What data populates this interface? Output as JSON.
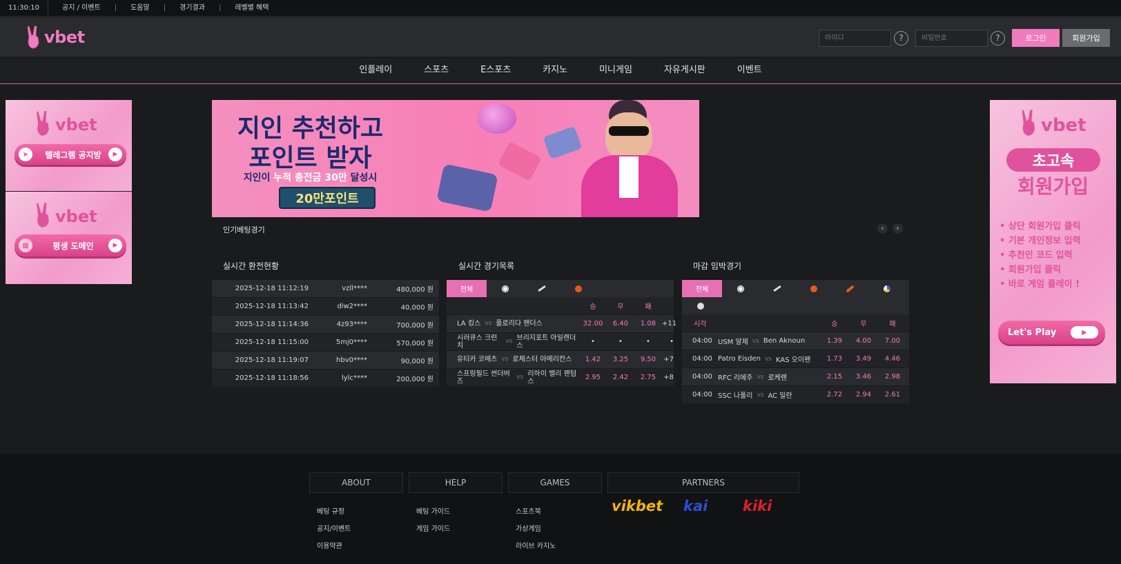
{
  "topbar": {
    "clock": "11:30:10",
    "links": [
      "공지 / 이벤트",
      "도움말",
      "경기결과",
      "레벨별 혜택"
    ]
  },
  "header": {
    "logo": "vbet",
    "id_placeholder": "아이디",
    "pw_placeholder": "비밀번호",
    "login_label": "로그인",
    "join_label": "회원가입"
  },
  "nav": [
    "인플레이",
    "스포츠",
    "E스포츠",
    "카지노",
    "미니게임",
    "자유게시판",
    "이벤트"
  ],
  "left_banners": [
    {
      "logo": "vbet",
      "pill": "텔레그램 공지방"
    },
    {
      "logo": "vbet",
      "pill": "평생 도메인"
    }
  ],
  "right_banner": {
    "logo": "vbet",
    "headline1": "초고속",
    "headline2": "회원가입",
    "steps": [
      "• 상단 회원가입 클릭",
      "• 기본 개인정보 입력",
      "• 추천인 코드 입력",
      "• 회원가입 클릭",
      "• 바로 게임 플레이 !"
    ],
    "cta": "Let's Play"
  },
  "main_banner": {
    "line1a": "지인 추천",
    "line1b": "하고",
    "line2": "포인트 받자",
    "line3a": "지인이 ",
    "line3b": "누적 충전금 30만",
    "line3c": " 달성시",
    "badge": "20만포인트"
  },
  "popular": {
    "label": "인기베팅경기",
    "prev": "‹",
    "next": "›"
  },
  "exchange": {
    "title": "실시간 환전현황",
    "rows": [
      {
        "time": "2025-12-18 11:12:19",
        "user": "vzll****",
        "amount": "480,000 원"
      },
      {
        "time": "2025-12-18 11:13:42",
        "user": "dlw2****",
        "amount": "40,000 원"
      },
      {
        "time": "2025-12-18 11:14:36",
        "user": "4z93****",
        "amount": "700,000 원"
      },
      {
        "time": "2025-12-18 11:15:00",
        "user": "5mj0****",
        "amount": "570,000 원"
      },
      {
        "time": "2025-12-18 11:19:07",
        "user": "hbv0****",
        "amount": "90,000 원"
      },
      {
        "time": "2025-12-18 11:18:56",
        "user": "lylc****",
        "amount": "200,000 원"
      }
    ]
  },
  "live": {
    "title": "실시간 경기목록",
    "tab_all": "전체",
    "col_win": "승",
    "col_draw": "무",
    "col_lose": "패",
    "vs": "vs",
    "rows": [
      {
        "home": "LA 킹스",
        "away": "플로리다 팬더스",
        "w": "32.00",
        "d": "6.40",
        "l": "1.08",
        "more": "+11"
      },
      {
        "home": "시러큐스 크런치",
        "away": "브리지포트 아일랜더스",
        "w": "•",
        "d": "•",
        "l": "•",
        "more": "•"
      },
      {
        "home": "유티카 코메츠",
        "away": "로체스터 아메리칸스",
        "w": "1.42",
        "d": "3.25",
        "l": "9.50",
        "more": "+7"
      },
      {
        "home": "스프링필드 썬더버즈",
        "away": "리하이 밸리 팬텀스",
        "w": "2.95",
        "d": "2.42",
        "l": "2.75",
        "more": "+8"
      }
    ]
  },
  "closing": {
    "title": "마감 임박경기",
    "tab_all": "전체",
    "col_time": "시각",
    "col_win": "승",
    "col_draw": "무",
    "col_lose": "패",
    "vs": "vs",
    "rows": [
      {
        "time": "04:00",
        "home": "USM 알제",
        "away": "Ben Aknoun",
        "w": "1.39",
        "d": "4.00",
        "l": "7.00"
      },
      {
        "time": "04:00",
        "home": "Patro Eisden",
        "away": "KAS 오이펜",
        "w": "1.73",
        "d": "3.49",
        "l": "4.46"
      },
      {
        "time": "04:00",
        "home": "RFC 리에주",
        "away": "로케렌",
        "w": "2.15",
        "d": "3.46",
        "l": "2.98"
      },
      {
        "time": "04:00",
        "home": "SSC 나폴리",
        "away": "AC 밀란",
        "w": "2.72",
        "d": "2.94",
        "l": "2.61"
      }
    ]
  },
  "footer": {
    "about": {
      "title": "ABOUT",
      "links": [
        "베팅 규정",
        "공지/이벤트",
        "이용약관"
      ]
    },
    "help": {
      "title": "HELP",
      "links": [
        "베팅 가이드",
        "게임 가이드"
      ]
    },
    "games": {
      "title": "GAMES",
      "links": [
        "스포츠북",
        "가상게임",
        "라이브 카지노"
      ]
    },
    "partners": {
      "title": "PARTNERS",
      "names": [
        "vikbet",
        "kai",
        "kiki"
      ]
    }
  },
  "colors": {
    "accent": "#f07bbf",
    "nav_border": "#d36ea8",
    "bg": "#1a1b1d"
  }
}
